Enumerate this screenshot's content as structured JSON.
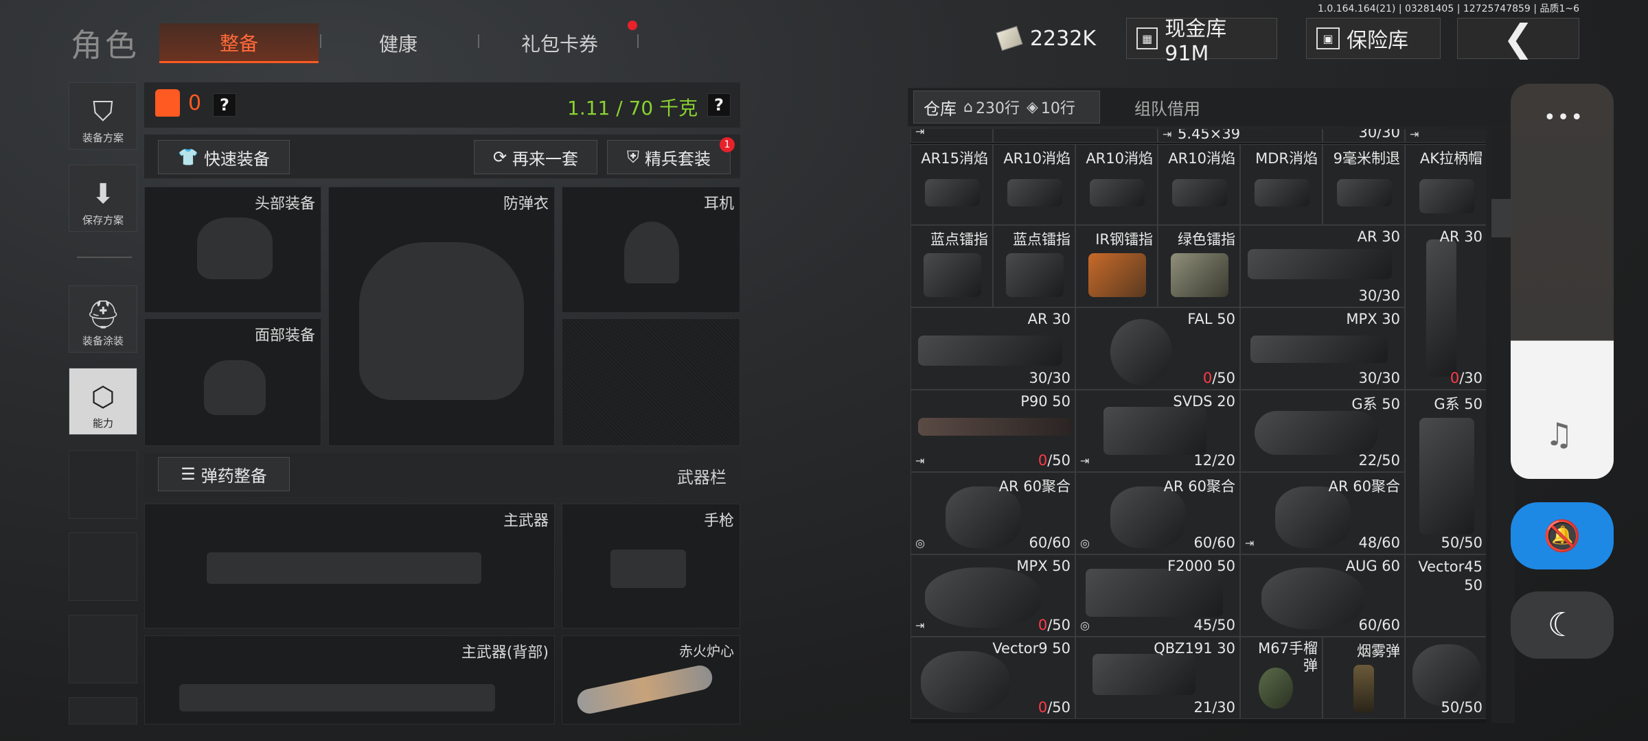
{
  "version": "1.0.164.164(21) | 03281405 | 12725747859 | 品质1~6",
  "header": {
    "title": "角色",
    "tabs": [
      {
        "label": "整备",
        "active": true
      },
      {
        "label": "健康",
        "active": false
      },
      {
        "label": "礼包卡券",
        "active": false,
        "has_dot": true
      }
    ],
    "money": "2232K",
    "cash_vault": "现金库 91M",
    "insurance": "保险库",
    "back_icon": "chevron-left-icon"
  },
  "sidebar": {
    "items": [
      {
        "label": "装备方案",
        "icon": "vest-icon"
      },
      {
        "label": "保存方案",
        "icon": "download-icon"
      },
      {
        "label": "装备涂装",
        "icon": "helmet-paint-icon"
      },
      {
        "label": "能力",
        "icon": "ability-icon",
        "active": true
      }
    ]
  },
  "equipment": {
    "armor_count": "0",
    "weight": "1.11 / 70 千克",
    "help_label": "?",
    "quick_equip": "快速装备",
    "again_set": "再来一套",
    "elite_set": "精兵套装",
    "elite_badge": "1",
    "slots": {
      "head": "头部装备",
      "vest": "防弹衣",
      "ear": "耳机",
      "face": "面部装备",
      "main_weapon": "主武器",
      "pistol": "手枪",
      "main_weapon_back": "主武器(背部)",
      "melee": "赤火炉心"
    },
    "ammo_btn": "弹药整备",
    "weapon_bar": "武器栏"
  },
  "warehouse": {
    "tab_store": "仓库",
    "rows_a": "230行",
    "rows_b": "10行",
    "tab_team": "组队借用",
    "top_partial": [
      "5.45×39",
      "30/30"
    ],
    "items": [
      {
        "name": "AR15消焰"
      },
      {
        "name": "AR10消焰"
      },
      {
        "name": "AR10消焰"
      },
      {
        "name": "AR10消焰"
      },
      {
        "name": "MDR消焰"
      },
      {
        "name": "9毫米制退"
      },
      {
        "name": "AK拉柄帽"
      },
      {
        "name": "蓝点镭指"
      },
      {
        "name": "蓝点镭指"
      },
      {
        "name": "IR钢镭指"
      },
      {
        "name": "绿色镭指"
      },
      {
        "name": "AR 30",
        "count": "30/30"
      },
      {
        "name": "AR 30",
        "count": "0/30"
      },
      {
        "name": "AR 30",
        "count": "30/30"
      },
      {
        "name": "FAL 50",
        "count_red": "0",
        "count_tail": "/50"
      },
      {
        "name": "MPX 30",
        "count": "30/30"
      },
      {
        "name": "P90 50",
        "count_red": "0",
        "count_tail": "/50"
      },
      {
        "name": "SVDS 20",
        "count": "12/20"
      },
      {
        "name": "G系 50",
        "count": "22/50"
      },
      {
        "name": "G系 50",
        "count": "50/50"
      },
      {
        "name": "AR 60聚合",
        "count": "60/60"
      },
      {
        "name": "AR 60聚合",
        "count": "60/60"
      },
      {
        "name": "AR 60聚合",
        "count": "48/60"
      },
      {
        "name": "MPX 50",
        "count_red": "0",
        "count_tail": "/50"
      },
      {
        "name": "F2000 50",
        "count": "45/50"
      },
      {
        "name": "AUG 60",
        "count": "60/60"
      },
      {
        "name": "Vector45 50"
      },
      {
        "name": "Vector9 50",
        "count_red": "0",
        "count_tail": "/50"
      },
      {
        "name": "QBZ191 30",
        "count": "21/30"
      },
      {
        "name": "M67手榴弹"
      },
      {
        "name": "烟雾弹"
      },
      {
        "count": "50/50"
      }
    ]
  },
  "float_panel": {
    "dots": "•••",
    "music": "♫",
    "mute": "🔕",
    "moon": "☾"
  }
}
